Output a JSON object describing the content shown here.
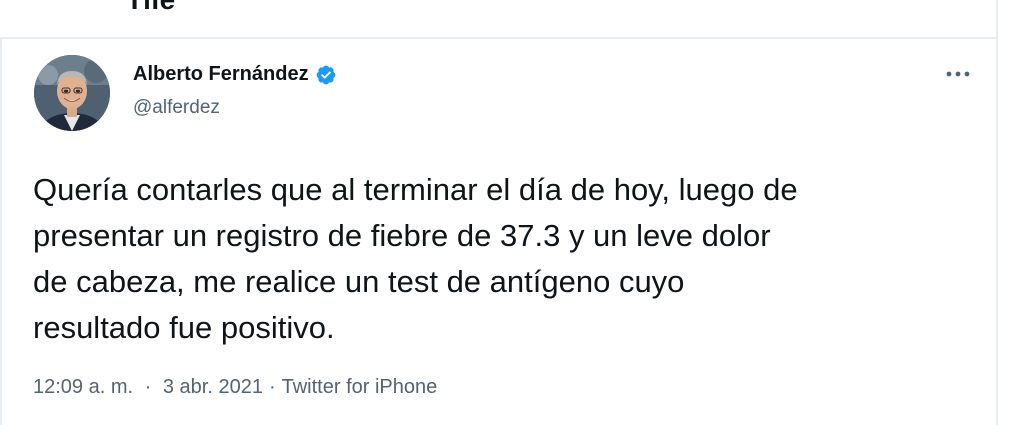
{
  "header": {
    "title": "Tile"
  },
  "tweet": {
    "author": {
      "name": "Alberto Fernández",
      "handle": "@alferdez",
      "verified": true
    },
    "text": "Quería contarles que al terminar el día de hoy, luego de\npresentar un registro de fiebre de 37.3 y un leve dolor\nde cabeza, me realice un test de antígeno cuyo\nresultado fue positivo.",
    "time": "12:09 a. m.",
    "separator": "·",
    "date": "3 abr. 2021",
    "source": "Twitter for iPhone"
  },
  "colors": {
    "verified_blue": "#1d9bf0",
    "text_primary": "#0f1419",
    "text_secondary": "#536471",
    "border": "#e6ecf0"
  },
  "icons": {
    "verified": "verified-badge-icon",
    "more": "more-horizontal-icon"
  }
}
